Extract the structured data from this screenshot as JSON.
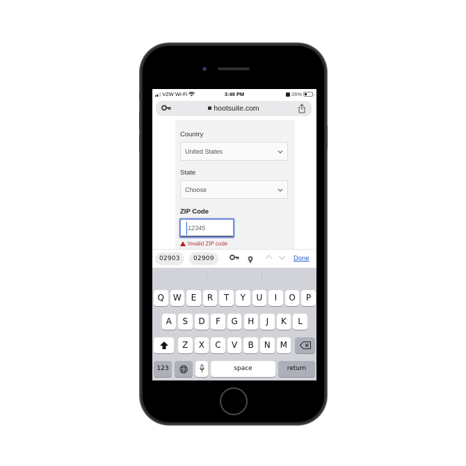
{
  "status_bar": {
    "carrier": "VZW Wi-Fi",
    "time": "3:49 PM",
    "battery_percent_label": "26%",
    "battery_level": 0.26
  },
  "url_bar": {
    "domain": "hootsuite.com",
    "left_icon": "key-icon",
    "right_icon": "share-icon"
  },
  "form": {
    "country": {
      "label": "Country",
      "value": "United States"
    },
    "state": {
      "label": "State",
      "value": "Choose"
    },
    "zip": {
      "label": "ZIP Code",
      "placeholder": "12345",
      "error": "Invalid ZIP code"
    }
  },
  "accessory_bar": {
    "suggestions": [
      "02903",
      "02909"
    ],
    "done_label": "Done"
  },
  "keyboard": {
    "row1": [
      "Q",
      "W",
      "E",
      "R",
      "T",
      "Y",
      "U",
      "I",
      "O",
      "P"
    ],
    "row2": [
      "A",
      "S",
      "D",
      "F",
      "G",
      "H",
      "J",
      "K",
      "L"
    ],
    "row3": [
      "Z",
      "X",
      "C",
      "V",
      "B",
      "N",
      "M"
    ],
    "numbers_label": "123",
    "space_label": "space",
    "return_label": "return"
  }
}
